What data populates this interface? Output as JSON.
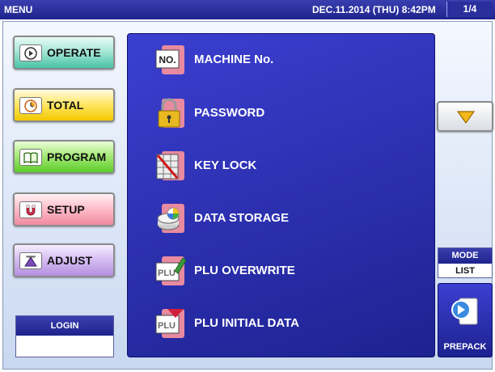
{
  "titlebar": {
    "title": "MENU",
    "datetime": "DEC.11.2014 (THU)  8:42PM",
    "page": "1/4"
  },
  "left_buttons": [
    {
      "label": "OPERATE",
      "icon": "play-circle-icon"
    },
    {
      "label": "TOTAL",
      "icon": "clock-icon"
    },
    {
      "label": "PROGRAM",
      "icon": "book-icon"
    },
    {
      "label": "SETUP",
      "icon": "magnet-icon"
    },
    {
      "label": "ADJUST",
      "icon": "ruler-triangle-icon"
    }
  ],
  "login": {
    "label": "LOGIN",
    "value": ""
  },
  "menu_items": [
    {
      "label": "MACHINE No.",
      "icon": "machine-number-icon"
    },
    {
      "label": "PASSWORD",
      "icon": "padlock-icon"
    },
    {
      "label": "KEY LOCK",
      "icon": "key-lock-icon"
    },
    {
      "label": "DATA STORAGE",
      "icon": "data-storage-icon"
    },
    {
      "label": "PLU OVERWRITE",
      "icon": "plu-overwrite-icon"
    },
    {
      "label": "PLU INITIAL DATA",
      "icon": "plu-initial-data-icon"
    }
  ],
  "scroll_down": {
    "icon": "triangle-down-icon"
  },
  "mode": {
    "label": "MODE",
    "value": "LIST"
  },
  "prepack": {
    "label": "PREPACK",
    "icon": "prepack-arrow-icon"
  }
}
